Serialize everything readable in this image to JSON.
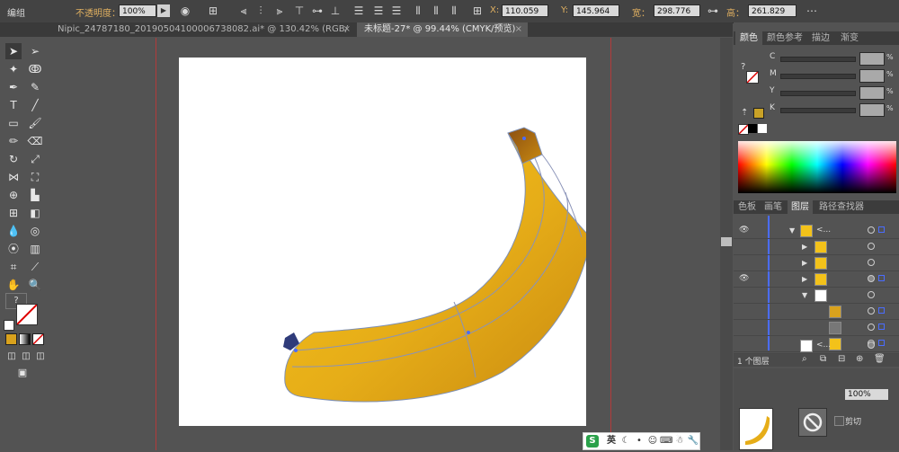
{
  "control_bar": {
    "group_label": "编组",
    "opacity_label": "不透明度：",
    "opacity_value": "100%",
    "x_label": "X:",
    "x_value": "110.059",
    "y_label": "Y:",
    "y_value": "145.964",
    "w_label": "宽：",
    "w_value": "298.776",
    "h_label": "高：",
    "h_value": "261.829"
  },
  "tabs": [
    {
      "label": "Nipic_24787180_20190504100006738082.ai* @ 130.42% (RGB/预览)",
      "close": "×"
    },
    {
      "label": "未标题-27* @ 99.44% (CMYK/预览)",
      "close": "×"
    }
  ],
  "color_panel": {
    "tabs": [
      "颜色",
      "颜色参考",
      "描边",
      "渐变"
    ],
    "channels": [
      {
        "name": "C",
        "pct": "%"
      },
      {
        "name": "M",
        "pct": "%"
      },
      {
        "name": "Y",
        "pct": "%"
      },
      {
        "name": "K",
        "pct": "%"
      }
    ],
    "fill_color": "#c9a227",
    "question": "?"
  },
  "layers_panel": {
    "tabs": [
      "色板",
      "画笔",
      "图层",
      "路径查找器"
    ],
    "rows": [
      {
        "label": "<...",
        "indent": 0,
        "expanded": true,
        "eye": true
      },
      {
        "label": "",
        "indent": 1,
        "expanded": false,
        "eye": false
      },
      {
        "label": "",
        "indent": 1,
        "expanded": false,
        "eye": false
      },
      {
        "label": "",
        "indent": 1,
        "expanded": false,
        "eye": true
      },
      {
        "label": "",
        "indent": 1,
        "expanded": true,
        "eye": false
      },
      {
        "label": "",
        "indent": 2,
        "expanded": false,
        "eye": false
      },
      {
        "label": "",
        "indent": 2,
        "expanded": false,
        "eye": false
      },
      {
        "label": "",
        "indent": 2,
        "expanded": false,
        "eye": false
      },
      {
        "label": "<...",
        "indent": 0,
        "expanded": false,
        "eye": false
      }
    ],
    "footer_count": "1 个图层",
    "opacity_field": "100%",
    "clip_label": "剪切"
  },
  "ime": {
    "lang": "英"
  },
  "colors": {
    "banana_dark": "#c98a10",
    "banana_light": "#f3c21a",
    "guide": "#b23a3a"
  }
}
